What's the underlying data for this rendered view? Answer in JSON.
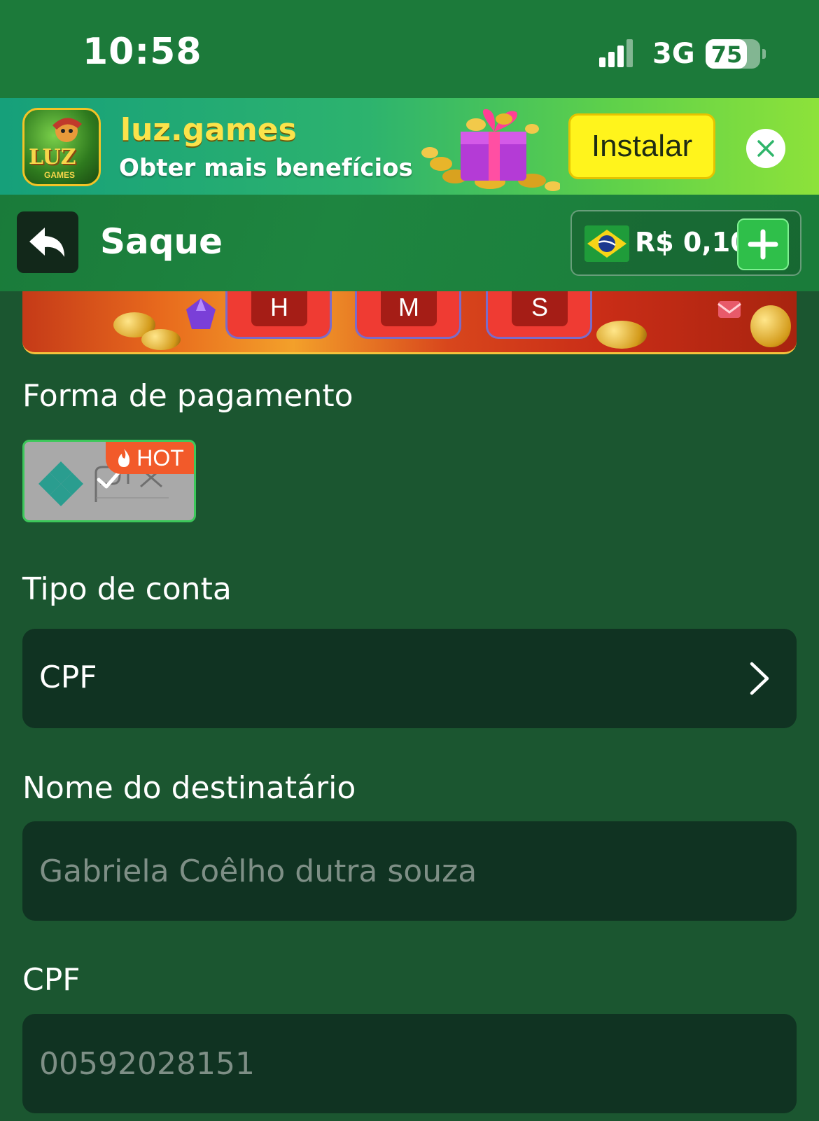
{
  "status_bar": {
    "time": "10:58",
    "network": "3G",
    "battery": "75",
    "battery_level_percent": 75
  },
  "install_banner": {
    "app_name": "luz.games",
    "tagline": "Obter mais benefícios",
    "logo_text": "LUZ",
    "logo_subtext": "GAMES",
    "install_label": "Instalar",
    "close_icon": "close-icon",
    "accent_color": "#fff41c"
  },
  "header": {
    "title": "Saque",
    "back_icon": "back-arrow-icon",
    "balance": "R$ 0,10",
    "flag_icon": "brazil-flag-icon",
    "deposit_icon": "plus-icon"
  },
  "promo": {
    "countdown_labels": [
      "H",
      "M",
      "S"
    ]
  },
  "form": {
    "payment_method_label": "Forma de pagamento",
    "payment_method": {
      "name": "pix-logo",
      "badge": "HOT",
      "badge_icon": "flame-icon",
      "selected": true,
      "check_icon": "check-icon"
    },
    "account_type_label": "Tipo de conta",
    "account_type_value": "CPF",
    "recipient_label": "Nome do destinatário",
    "recipient_placeholder": "Gabriela Coêlho dutra souza",
    "cpf_label": "CPF",
    "cpf_placeholder": "00592028151"
  },
  "colors": {
    "background": "#1b5630",
    "header": "#1c7a3a",
    "field": "#103322",
    "hot_badge": "#f25a2a",
    "selected_border": "#3cc85a"
  }
}
